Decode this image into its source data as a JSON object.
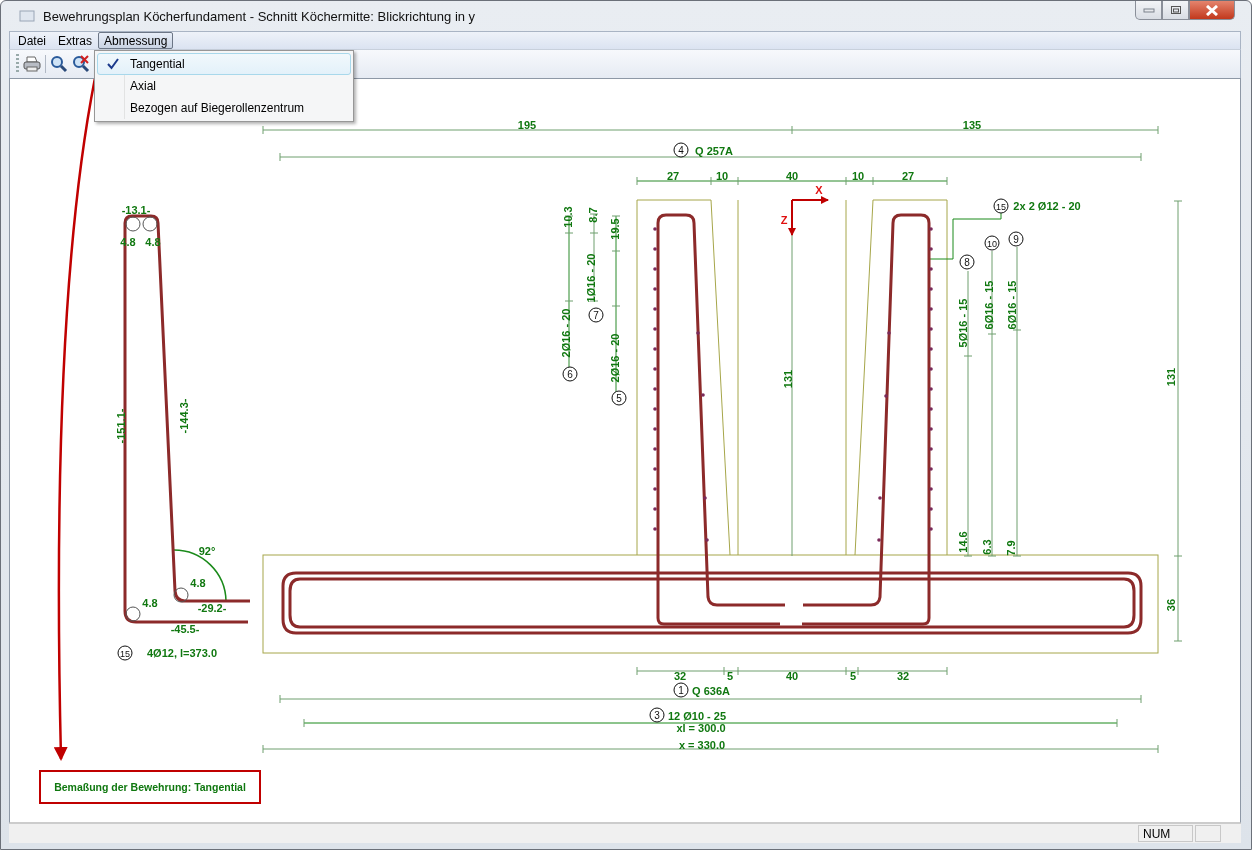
{
  "window": {
    "title": "Bewehrungsplan Köcherfundament - Schnitt Köchermitte: Blickrichtung in y"
  },
  "menu": [
    {
      "label": "Datei",
      "selected": false
    },
    {
      "label": "Extras",
      "selected": false
    },
    {
      "label": "Abmessung",
      "selected": true
    }
  ],
  "dropdown": {
    "items": [
      {
        "label": "Tangential",
        "checked": true,
        "selected": true
      },
      {
        "label": "Axial",
        "checked": false,
        "selected": false
      },
      {
        "label": "Bezogen auf Biegerollenzentrum",
        "checked": false,
        "selected": false
      }
    ]
  },
  "drawing": {
    "labels": [
      {
        "text": "195",
        "kind": "dimension"
      },
      {
        "text": "135",
        "kind": "dimension"
      },
      {
        "text": "Q 257A",
        "kind": "dimension"
      },
      {
        "text": "27",
        "kind": "dimension"
      },
      {
        "text": "10",
        "kind": "dimension"
      },
      {
        "text": "40",
        "kind": "dimension"
      },
      {
        "text": "10",
        "kind": "dimension"
      },
      {
        "text": "27",
        "kind": "dimension"
      },
      {
        "text": "X",
        "kind": "axis"
      },
      {
        "text": "Z",
        "kind": "axis"
      },
      {
        "text": "2x 2 Ø12 - 20",
        "kind": "dimension"
      },
      {
        "text": "10.3",
        "kind": "dimension"
      },
      {
        "text": "8.7",
        "kind": "dimension"
      },
      {
        "text": "19.5",
        "kind": "dimension"
      },
      {
        "text": "1Ø16 - 20",
        "kind": "dimension"
      },
      {
        "text": "2Ø16 - 20",
        "kind": "dimension"
      },
      {
        "text": "2Ø16 - 20",
        "kind": "dimension"
      },
      {
        "text": "131",
        "kind": "dimension"
      },
      {
        "text": "5Ø16 - 15",
        "kind": "dimension"
      },
      {
        "text": "6Ø16 - 15",
        "kind": "dimension"
      },
      {
        "text": "6Ø16 - 15",
        "kind": "dimension"
      },
      {
        "text": "131",
        "kind": "dimension"
      },
      {
        "text": "14.6",
        "kind": "dimension"
      },
      {
        "text": "6.3",
        "kind": "dimension"
      },
      {
        "text": "7.9",
        "kind": "dimension"
      },
      {
        "text": "36",
        "kind": "dimension"
      },
      {
        "text": "32",
        "kind": "dimension"
      },
      {
        "text": "5",
        "kind": "dimension"
      },
      {
        "text": "40",
        "kind": "dimension"
      },
      {
        "text": "5",
        "kind": "dimension"
      },
      {
        "text": "32",
        "kind": "dimension"
      },
      {
        "text": "Q 636A",
        "kind": "dimension"
      },
      {
        "text": "12 Ø10 - 25",
        "kind": "dimension"
      },
      {
        "text": "xl = 300.0",
        "kind": "dimension"
      },
      {
        "text": "x = 330.0",
        "kind": "dimension"
      },
      {
        "text": "-13.1-",
        "kind": "dimension"
      },
      {
        "text": "4.8",
        "kind": "dimension"
      },
      {
        "text": "4.8",
        "kind": "dimension"
      },
      {
        "text": "-151.1-",
        "kind": "dimension"
      },
      {
        "text": "-144.3-",
        "kind": "dimension"
      },
      {
        "text": "92°",
        "kind": "dimension"
      },
      {
        "text": "4.8",
        "kind": "dimension"
      },
      {
        "text": "4.8",
        "kind": "dimension"
      },
      {
        "text": "-29.2-",
        "kind": "dimension"
      },
      {
        "text": "-45.5-",
        "kind": "dimension"
      },
      {
        "text": "4Ø12, l=373.0",
        "kind": "dimension"
      }
    ],
    "markers": [
      {
        "number": "4"
      },
      {
        "number": "15"
      },
      {
        "number": "10"
      },
      {
        "number": "9"
      },
      {
        "number": "8"
      },
      {
        "number": "7"
      },
      {
        "number": "6"
      },
      {
        "number": "5"
      },
      {
        "number": "1"
      },
      {
        "number": "3"
      },
      {
        "number": "15"
      }
    ]
  },
  "annotation": {
    "text": "Bemaßung der Bewehrung: Tangential"
  },
  "status_bar": {
    "indicator": "NUM"
  }
}
